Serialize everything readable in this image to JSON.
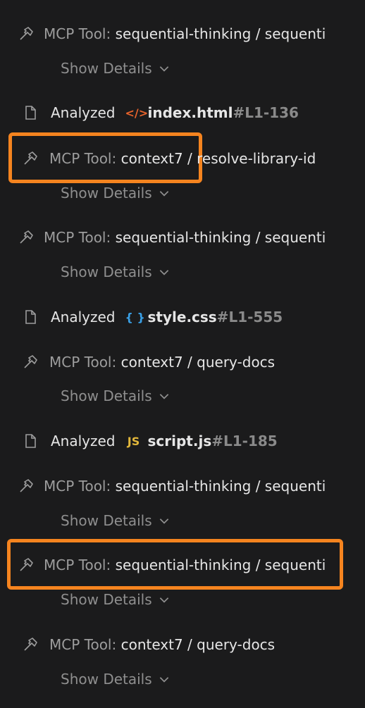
{
  "rows": [
    {
      "type": "tool",
      "label": "MCP Tool:",
      "name": "sequential-thinking / sequenti"
    },
    {
      "type": "details",
      "label": "Show Details"
    },
    {
      "type": "file",
      "action": "Analyzed",
      "lang_icon": "</>",
      "file": "index.html",
      "range": "#L1-136",
      "icon_color": "#e8632b"
    },
    {
      "type": "tool",
      "label": "MCP Tool:",
      "name": "context7 / resolve-library-id"
    },
    {
      "type": "details",
      "label": "Show Details"
    },
    {
      "type": "tool",
      "label": "MCP Tool:",
      "name": "sequential-thinking / sequenti"
    },
    {
      "type": "details",
      "label": "Show Details"
    },
    {
      "type": "file",
      "action": "Analyzed",
      "lang_icon": "{ }",
      "file": "style.css",
      "range": "#L1-555",
      "icon_color": "#3aa0e6"
    },
    {
      "type": "tool",
      "label": "MCP Tool:",
      "name": "context7 / query-docs"
    },
    {
      "type": "details",
      "label": "Show Details"
    },
    {
      "type": "file",
      "action": "Analyzed",
      "lang_icon": "JS",
      "file": "script.js",
      "range": "#L1-185",
      "icon_color": "#e2b73b"
    },
    {
      "type": "tool",
      "label": "MCP Tool:",
      "name": "sequential-thinking / sequenti"
    },
    {
      "type": "details",
      "label": "Show Details"
    },
    {
      "type": "tool",
      "label": "MCP Tool:",
      "name": "sequential-thinking / sequenti"
    },
    {
      "type": "details",
      "label": "Show Details"
    },
    {
      "type": "tool",
      "label": "MCP Tool:",
      "name": "context7 / query-docs"
    },
    {
      "type": "details",
      "label": "Show Details"
    }
  ],
  "highlight_color": "#f5841f"
}
